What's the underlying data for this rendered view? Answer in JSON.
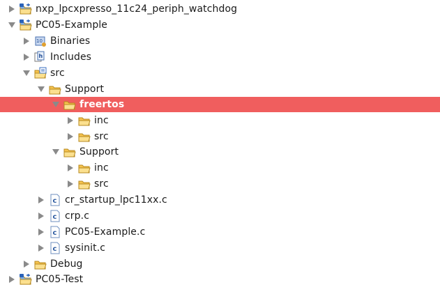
{
  "tree": {
    "items": [
      {
        "label": "nxp_lpcxpresso_11c24_periph_watchdog",
        "depth": 0,
        "expanded": false,
        "icon": "project-folder-icon",
        "selected": false
      },
      {
        "label": "PC05-Example",
        "depth": 0,
        "expanded": true,
        "icon": "project-folder-icon",
        "selected": false
      },
      {
        "label": "Binaries",
        "depth": 1,
        "expanded": false,
        "icon": "binaries-icon",
        "selected": false
      },
      {
        "label": "Includes",
        "depth": 1,
        "expanded": false,
        "icon": "includes-icon",
        "selected": false
      },
      {
        "label": "src",
        "depth": 1,
        "expanded": true,
        "icon": "source-folder-icon",
        "selected": false
      },
      {
        "label": "Support",
        "depth": 2,
        "expanded": true,
        "icon": "folder-icon",
        "selected": false
      },
      {
        "label": "freertos",
        "depth": 3,
        "expanded": true,
        "icon": "folder-icon",
        "selected": true
      },
      {
        "label": "inc",
        "depth": 4,
        "expanded": false,
        "icon": "folder-icon",
        "selected": false
      },
      {
        "label": "src",
        "depth": 4,
        "expanded": false,
        "icon": "folder-icon",
        "selected": false
      },
      {
        "label": "Support",
        "depth": 3,
        "expanded": true,
        "icon": "folder-icon",
        "selected": false
      },
      {
        "label": "inc",
        "depth": 4,
        "expanded": false,
        "icon": "folder-icon",
        "selected": false
      },
      {
        "label": "src",
        "depth": 4,
        "expanded": false,
        "icon": "folder-icon",
        "selected": false
      },
      {
        "label": "cr_startup_lpc11xx.c",
        "depth": 2,
        "expanded": false,
        "icon": "c-file-icon",
        "selected": false
      },
      {
        "label": "crp.c",
        "depth": 2,
        "expanded": false,
        "icon": "c-file-icon",
        "selected": false
      },
      {
        "label": "PC05-Example.c",
        "depth": 2,
        "expanded": false,
        "icon": "c-file-icon",
        "selected": false
      },
      {
        "label": "sysinit.c",
        "depth": 2,
        "expanded": false,
        "icon": "c-file-icon",
        "selected": false
      },
      {
        "label": "Debug",
        "depth": 1,
        "expanded": false,
        "icon": "folder-icon",
        "selected": false
      },
      {
        "label": "PC05-Test",
        "depth": 0,
        "expanded": false,
        "icon": "project-folder-icon",
        "selected": false
      }
    ]
  },
  "colors": {
    "selection": "#f05e5e",
    "folder": "#f6c34e",
    "twisty": "#8a8a8a"
  }
}
